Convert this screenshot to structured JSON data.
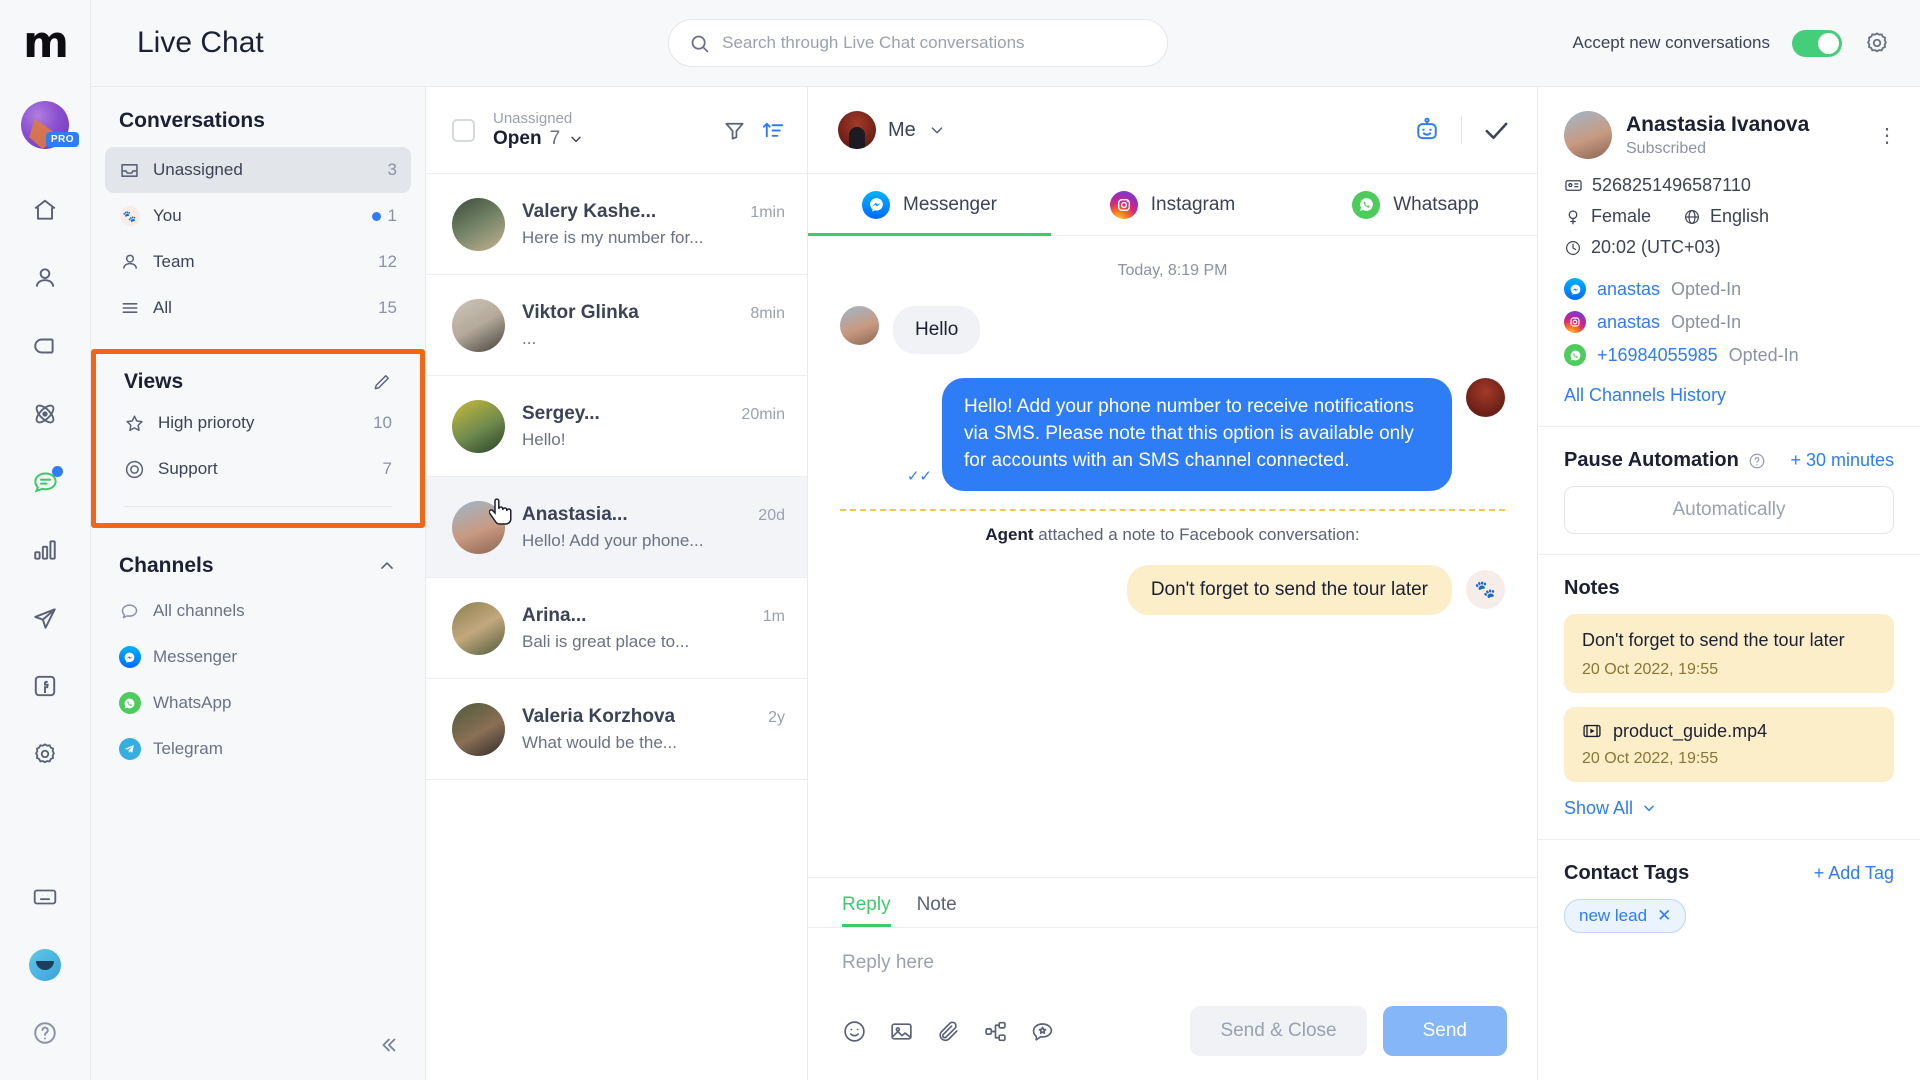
{
  "header": {
    "title": "Live Chat",
    "logo": "m-logo",
    "search_placeholder": "Search through Live Chat conversations",
    "accept_label": "Accept new conversations",
    "accept_enabled": true,
    "gear_icon": "gear-icon"
  },
  "rail": {
    "avatar_badge": "PRO",
    "icons": [
      {
        "name": "home-icon"
      },
      {
        "name": "contacts-icon"
      },
      {
        "name": "flows-icon"
      },
      {
        "name": "broadcast-icon"
      },
      {
        "name": "live-chat-icon",
        "active": true,
        "dot": true
      },
      {
        "name": "analytics-icon"
      },
      {
        "name": "send-icon"
      },
      {
        "name": "facebook-icon"
      },
      {
        "name": "settings-icon"
      },
      {
        "name": "keyboard-icon"
      },
      {
        "name": "user-avatar-icon"
      },
      {
        "name": "help-icon"
      }
    ]
  },
  "nav": {
    "conversations_title": "Conversations",
    "conversation_items": [
      {
        "label": "Unassigned",
        "count": "3",
        "icon": "inbox-icon",
        "active": true,
        "dot": false
      },
      {
        "label": "You",
        "count": "1",
        "icon": "you-avatar-icon",
        "active": false,
        "dot": true
      },
      {
        "label": "Team",
        "count": "12",
        "icon": "team-icon",
        "active": false,
        "dot": false
      },
      {
        "label": "All",
        "count": "15",
        "icon": "all-icon",
        "active": false,
        "dot": false
      }
    ],
    "views_title": "Views",
    "views_edit_icon": "pencil-icon",
    "views_items": [
      {
        "label": "High prioroty",
        "count": "10",
        "icon": "star-icon"
      },
      {
        "label": "Support",
        "count": "7",
        "icon": "lifebuoy-icon"
      }
    ],
    "channels_title": "Channels",
    "channels_chevron": "chevron-up-icon",
    "channels_items": [
      {
        "label": "All channels",
        "icon": "chat-bubble-icon"
      },
      {
        "label": "Messenger",
        "icon": "messenger-icon"
      },
      {
        "label": "WhatsApp",
        "icon": "whatsapp-icon"
      },
      {
        "label": "Telegram",
        "icon": "telegram-icon"
      }
    ],
    "collapse_icon": "collapse-left-icon"
  },
  "conversations": {
    "header": {
      "sub": "Unassigned",
      "status": "Open",
      "count": "7",
      "chevron": "chevron-down-icon",
      "filter_icon": "filter-icon",
      "sort_icon": "sort-ascending-icon"
    },
    "rows": [
      {
        "name": "Valery Kashe...",
        "time": "1min",
        "preview": "Here is my number for...",
        "selected": false
      },
      {
        "name": "Viktor Glinka",
        "time": "8min",
        "preview": "...",
        "selected": false
      },
      {
        "name": "Sergey...",
        "time": "20min",
        "preview": "Hello!",
        "selected": false
      },
      {
        "name": "Anastasia...",
        "time": "20d",
        "preview": "Hello! Add your phone...",
        "selected": true
      },
      {
        "name": "Arina...",
        "time": "1m",
        "preview": "Bali is great place to...",
        "selected": false
      },
      {
        "name": "Valeria Korzhova",
        "time": "2y",
        "preview": "What would be the...",
        "selected": false
      }
    ]
  },
  "chat": {
    "assignee": "Me",
    "assignee_chevron": "chevron-down-icon",
    "bot_icon": "bot-icon",
    "resolve_icon": "check-icon",
    "tabs": [
      {
        "label": "Messenger",
        "icon": "messenger-icon",
        "active": true
      },
      {
        "label": "Instagram",
        "icon": "instagram-icon",
        "active": false
      },
      {
        "label": "Whatsapp",
        "icon": "whatsapp-icon",
        "active": false
      }
    ],
    "day_separator": "Today, 8:19 PM",
    "messages": [
      {
        "dir": "in",
        "text": "Hello"
      },
      {
        "dir": "out",
        "text": "Hello! Add your phone number to receive notifications via SMS. Please note that this option is available only for accounts with an SMS channel connected.",
        "status": "read"
      }
    ],
    "note_event": {
      "actor": "Agent",
      "text": "attached a note to Facebook conversation:",
      "note": "Don't forget to send the tour later"
    },
    "composer": {
      "tabs": [
        {
          "label": "Reply",
          "active": true
        },
        {
          "label": "Note",
          "active": false
        }
      ],
      "placeholder": "Reply here",
      "icons": [
        {
          "name": "emoji-icon"
        },
        {
          "name": "image-icon"
        },
        {
          "name": "attachment-icon"
        },
        {
          "name": "flow-icon"
        },
        {
          "name": "saved-reply-icon"
        }
      ],
      "send_close_label": "Send & Close",
      "send_label": "Send"
    }
  },
  "contact": {
    "name": "Anastasia Ivanova",
    "status": "Subscribed",
    "more_icon": "more-vertical-icon",
    "id": "5268251496587110",
    "id_icon": "id-card-icon",
    "gender": "Female",
    "gender_icon": "female-icon",
    "language": "English",
    "language_icon": "globe-icon",
    "time": "20:02 (UTC+03)",
    "time_icon": "clock-icon",
    "channels": [
      {
        "icon": "messenger-icon",
        "handle": "anastas",
        "status": "Opted-In"
      },
      {
        "icon": "instagram-icon",
        "handle": "anastas",
        "status": "Opted-In"
      },
      {
        "icon": "whatsapp-icon",
        "handle": "+16984055985",
        "status": "Opted-In"
      }
    ],
    "all_history_link": "All Channels History",
    "pause_automation": {
      "title": "Pause Automation",
      "help_icon": "question-circle-icon",
      "add_link": "+ 30 minutes",
      "current": "Automatically"
    },
    "notes": {
      "title": "Notes",
      "items": [
        {
          "type": "text",
          "text": "Don't forget to send the tour later",
          "date": "20 Oct 2022, 19:55"
        },
        {
          "type": "file",
          "text": "product_guide.mp4",
          "icon": "video-file-icon",
          "date": "20 Oct 2022, 19:55"
        }
      ],
      "show_all": "Show All",
      "show_all_chevron": "chevron-down-icon"
    },
    "tags": {
      "title": "Contact Tags",
      "add_label": "+ Add Tag",
      "items": [
        {
          "label": "new lead"
        }
      ]
    }
  },
  "colors": {
    "accent_blue": "#2f7df6",
    "accent_green": "#3ec96a",
    "highlight_orange": "#f0671a",
    "note_yellow": "#fceec9"
  }
}
